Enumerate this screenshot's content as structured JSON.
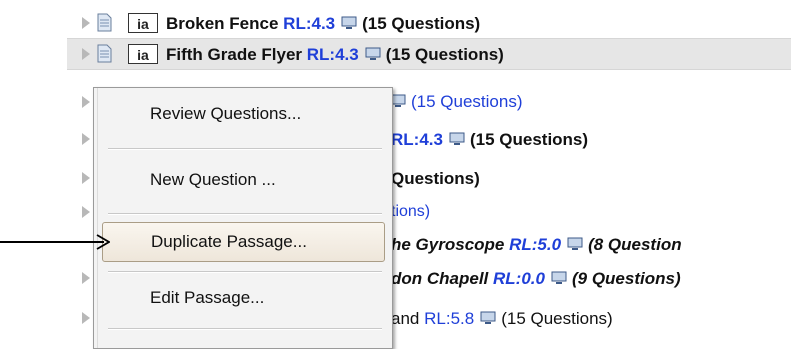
{
  "tree": {
    "rows": [
      {
        "title": "Broken Fence",
        "rl": "RL:4.3",
        "count": "(15 Questions)"
      },
      {
        "title": "Fifth Grade Flyer",
        "rl": "RL:4.3",
        "count": "(15 Questions)"
      },
      {
        "fragment": "(15 Questions)"
      },
      {
        "rl": "RL:4.3",
        "count": "(15 Questions)"
      },
      {
        "fragment": "Questions)"
      },
      {
        "fragment": "tions)"
      },
      {
        "title": "he Gyroscope",
        "rl": "RL:5.0",
        "count": "(8 Question"
      },
      {
        "title": "don Chapell",
        "rl": "RL:0.0",
        "count": "(9 Questions)"
      },
      {
        "title": "and",
        "rl": "RL:5.8",
        "count": "(15 Questions)"
      }
    ],
    "badge": "ia",
    "icons": [
      "expand-triangle-icon",
      "document-icon",
      "monitor-icon"
    ]
  },
  "context_menu": {
    "items": [
      {
        "label": "Review Questions..."
      },
      {
        "label": "New Question ..."
      },
      {
        "label": "Duplicate Passage..."
      },
      {
        "label": "Edit Passage..."
      }
    ],
    "highlighted": "Duplicate Passage..."
  },
  "annotation": {
    "icon": "pointer-arrow-icon"
  }
}
